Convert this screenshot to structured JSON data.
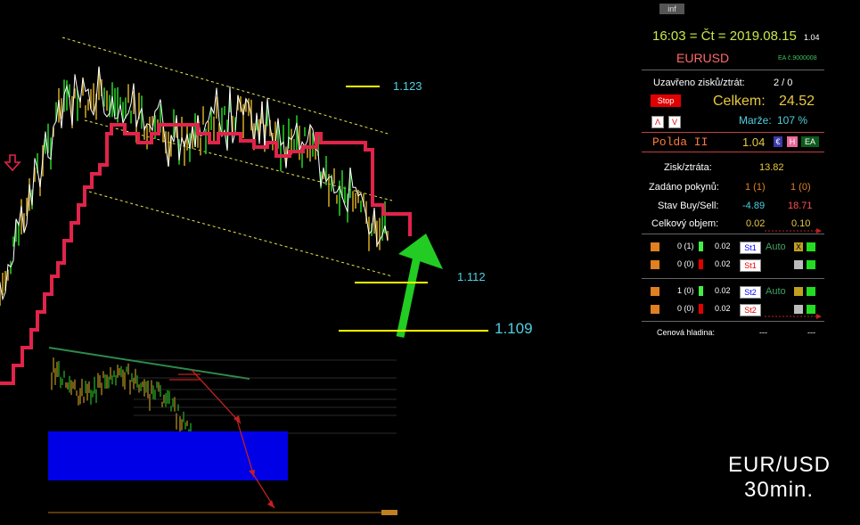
{
  "chart": {
    "price_labels": [
      "1.123",
      "1.112",
      "1.109"
    ],
    "symbol_large": "EUR/USD",
    "timeframe_large": "30min."
  },
  "panel": {
    "inf_button": "inf",
    "datetime": "16:03 = Čt = 2019.08.15",
    "version": "1.04",
    "symbol": "EURUSD",
    "ea_id": "EA č.9000008",
    "closed_label": "Uzavřeno zisků/ztrát:",
    "closed_value": "2 / 0",
    "stop_button": "Stop",
    "total_label": "Celkem:",
    "total_value": "24.52",
    "margin_label": "Marže:",
    "margin_value": "107 %",
    "up_button": "Λ",
    "down_button": "V",
    "ea_name": "Polda II",
    "ea_version": "1.04",
    "btn_e": "€",
    "btn_h": "H",
    "btn_ea": "EA",
    "profit_label": "Zisk/ztráta:",
    "profit_value": "13.82",
    "orders_label": "Zadáno pokynů:",
    "orders_buy": "1 (1)",
    "orders_sell": "1 (0)",
    "state_label": "Stav Buy/Sell:",
    "state_buy": "-4.89",
    "state_sell": "18.71",
    "volume_label": "Celkový objem:",
    "volume_buy": "0.02",
    "volume_sell": "0.10",
    "rows": [
      {
        "count": "0 (1)",
        "lot": "0.02",
        "tag": "St1",
        "auto": "Auto",
        "x": "X"
      },
      {
        "count": "0 (0)",
        "lot": "0.02",
        "tag": "St1"
      },
      {
        "count": "1 (0)",
        "lot": "0.02",
        "tag": "St2",
        "auto": "Auto"
      },
      {
        "count": "0 (0)",
        "lot": "0.02",
        "tag": "St2"
      }
    ],
    "price_level_label": "Cenová hladina:",
    "price_level_a": "---",
    "price_level_b": "---"
  },
  "colors": {
    "background": "#000000",
    "accent_red": "#e0244a",
    "band_white": "#ffffff",
    "channel_yellow": "#e8e84a",
    "arrow_green": "#22cc22",
    "label_cyan": "#4fd0e0",
    "panel_yellow": "#e8c840",
    "panel_orange": "#e08020",
    "panel_red": "#ff5050",
    "panel_green": "#44ee44",
    "inset_blue": "#0000e6"
  }
}
